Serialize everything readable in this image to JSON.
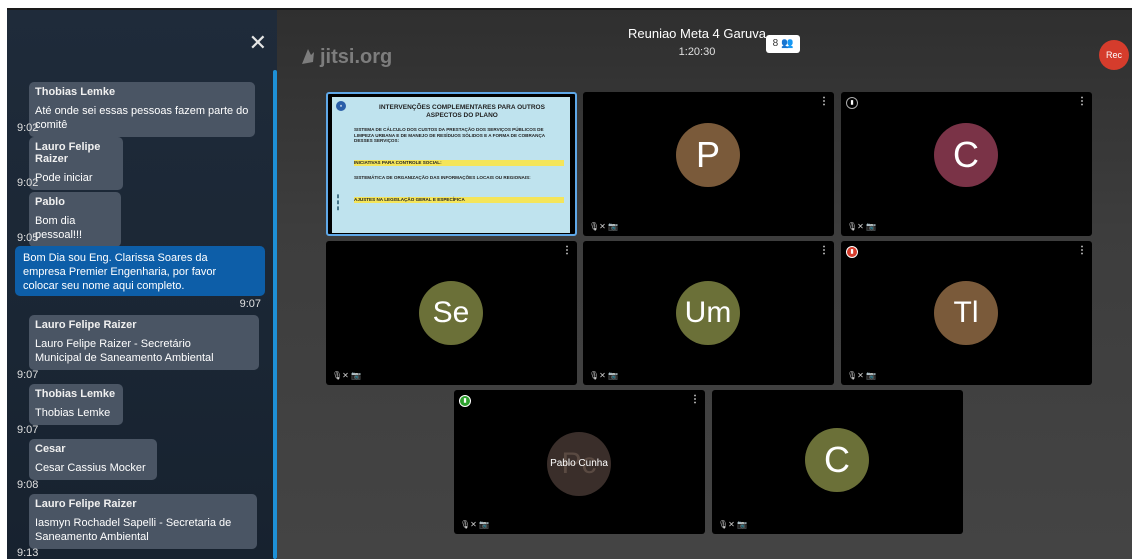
{
  "chat": {
    "messages": [
      {
        "sender": "Thobias Lemke",
        "text": "Até onde sei essas pessoas fazem parte do comitê",
        "time": "9:02"
      },
      {
        "sender": "Lauro Felipe Raizer",
        "text": "Pode iniciar",
        "time": "9:02"
      },
      {
        "sender": "Pablo",
        "text": "Bom dia pessoal!!!",
        "time": "9:05"
      },
      {
        "sender": "",
        "text": "Bom Dia sou Eng. Clarissa Soares da empresa Premier Engenharia, por favor colocar seu nome aqui completo.",
        "time": "9:07"
      },
      {
        "sender": "Lauro Felipe Raizer",
        "text": "Lauro Felipe Raizer - Secretário Municipal de Saneamento Ambiental",
        "time": "9:07"
      },
      {
        "sender": "Thobias Lemke",
        "text": "Thobias Lemke",
        "time": "9:07"
      },
      {
        "sender": "Cesar",
        "text": "Cesar Cassius Mocker",
        "time": "9:08"
      },
      {
        "sender": "Lauro Felipe Raizer",
        "text": "Iasmyn Rochadel Sapelli - Secretaria de Saneamento Ambiental",
        "time": "9:13"
      }
    ]
  },
  "header": {
    "logo": "jitsi.org",
    "title": "Reuniao Meta 4 Garuva",
    "timer": "1:20:30",
    "participant_count": "8",
    "rec_label": "Rec"
  },
  "slide": {
    "title": "INTERVENÇÕES COMPLEMENTARES PARA OUTROS ASPECTOS DO PLANO",
    "rows": [
      "SISTEMA DE CÁLCULO DOS CUSTOS DA PRESTAÇÃO DOS SERVIÇOS PÚBLICOS DE LIMPEZA URBANA E DE MANEJO DE RESÍDUOS SÓLIDOS E A FORMA DE COBRANÇA DESSES SERVIÇOS:",
      "INICIATIVAS PARA CONTROLE SOCIAL:",
      "SISTEMÁTICA DE ORGANIZAÇÃO DAS INFORMAÇÕES LOCAIS OU REGIONAIS:",
      "AJUSTES NA LEGISLAÇÃO GERAL E ESPECÍFICA"
    ]
  },
  "tiles": [
    {
      "initials": "P",
      "color": "#7a5a3a"
    },
    {
      "initials": "C",
      "color": "#7a3347"
    },
    {
      "initials": "Se",
      "color": "#6b7038"
    },
    {
      "initials": "Um",
      "color": "#6b7038"
    },
    {
      "initials": "Tl",
      "color": "#7a5a3a"
    },
    {
      "initials": "Pc",
      "color": "#3a2e2a",
      "name": "Pablo Cunha"
    },
    {
      "initials": "C",
      "color": "#6b7038"
    }
  ],
  "colors": {
    "accent": "#1e90d6",
    "own_bubble": "#0d5ea8",
    "rec": "#d53c2c"
  }
}
